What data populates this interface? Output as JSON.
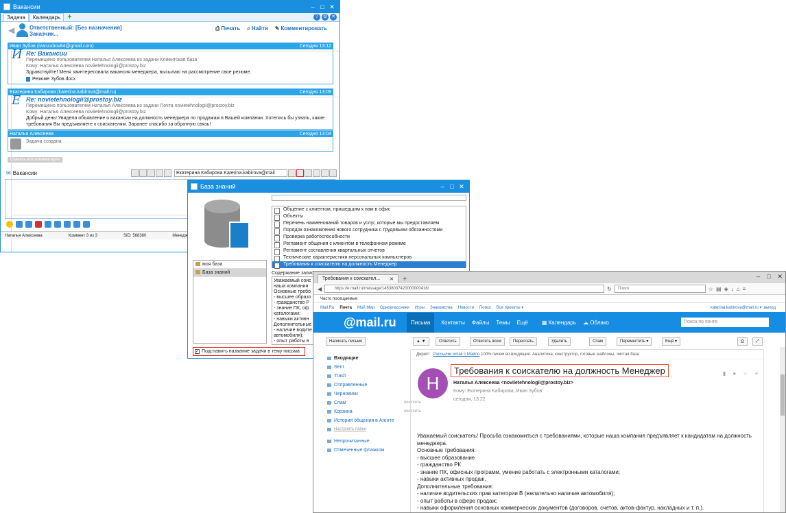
{
  "w1": {
    "title": "Вакансии",
    "tabs": [
      "Задача",
      "Календарь"
    ],
    "responsible": "Ответственный: [Без назначения]",
    "customer": "Заказчик...",
    "actions": [
      "Печать",
      "Найти",
      "Комментировать"
    ],
    "messages": [
      {
        "from": "Иван Зубов (ivanzubov84@gmail.com)",
        "time": "Сегодня 13:12",
        "letter": "И",
        "subject": "Re: Вакансии",
        "moved": "Перемещено пользователем Наталья Алексеева из задачи Клиентская база",
        "to": "Кому: Наталья Алексеева noviietehnologii@prostoy.biz",
        "text": "Здравствуйте! Меня заинтересовала вакансия менеджера, высылаю на рассмотрение свое резюме.",
        "attach": "Резюме Зубов.docx"
      },
      {
        "from": "Екатерина Кабирова (katerina.kabirova@mail.ru)",
        "time": "Сегодня 13:09",
        "letter": "E",
        "subject": "Re: novietehnologii@prostoy.biz",
        "moved": "Перемещено пользователем Наталья Алексеева из задачи Почта novietehnologii@prostoy.biz",
        "to": "Кому: Наталья Алексеева noviietehnologii@prostoy.biz",
        "text": "Добрый день! Увидела объявление о вакансии на должность менеджера по продажам в Вашей компании. Хотелось бы узнать, какие требования Вы предъявляете к соискателям. Заранее спасибо за обратную связь!"
      },
      {
        "from": "Наталья Алексеева",
        "time": "Сегодня 13:04",
        "text": "Задача создана"
      }
    ],
    "download_all": "Скачать все комментарии",
    "compose_label": "Вакансии",
    "recipient": "Екатерина Кабирова Katerina.kabirova@mail",
    "status": [
      "Наталья Алексеева",
      "Коммент 3 из 3",
      "SID: 568360",
      "Менеджм"
    ]
  },
  "w2": {
    "title": "База знаний",
    "tree": [
      "моя база",
      "База знаний"
    ],
    "items": [
      "Общение с клиентом, пришедшим к нам в офис",
      "Объекты",
      "Перечень наименований товаров и услуг, которые мы предоставляем",
      "Порядок ознакомления нового сотрудника с трудовыми обязанностями",
      "Проверка работоспособности",
      "Регламент общения с клиентом в телефонном режиме",
      "Регламент составления квартальных отчетов",
      "Технические характеристики персональных компьютеров",
      "Требования к соискателю на должность Менеджер"
    ],
    "content_label": "Содержание записи",
    "content_lines": [
      "Уважаемый соис",
      "наша компания",
      "Основные требо",
      "- высшее образо",
      "- гражданство Р",
      "- знание ПК, оф",
      "каталогами;",
      "- навыки активн",
      "Дополнительные",
      "- наличие водите",
      "автомобиля);",
      "- опыт работы в"
    ],
    "checkbox": "Подставить название задачи в тему письма"
  },
  "w3": {
    "tab_title": "Требования к соискател...",
    "url": "https://e.mail.ru/message/14538037420000000418/",
    "search_placeholder": "Поиск",
    "bookmark": "Часто посещаемые",
    "portal": [
      "Mail.Ru",
      "Почта",
      "Мой Мир",
      "Одноклассники",
      "Игры",
      "Знакомства",
      "Новости",
      "Поиск",
      "Все проекты ▾"
    ],
    "user": "katerina.kabirova@mail.ru ▾",
    "logout": "выход",
    "logo": "@mail.ru",
    "mail_tabs": [
      "Письма",
      "Контакты",
      "Файлы",
      "Темы",
      "Ещё"
    ],
    "calendar": "Календарь",
    "cloud": "Облако",
    "mail_search": "Поиск по почте",
    "write": "Написать письмо",
    "toolbar": [
      "Ответить",
      "Ответить всем",
      "Переслать",
      "Удалить",
      "Спам",
      "Переместить ▾",
      "Ещё ▾"
    ],
    "folders": [
      "Входящие",
      "Sent",
      "Trash",
      "Отправленные",
      "Черновики",
      "Спам",
      "Корзина",
      "История общения в Агенте",
      "Настроить папки",
      "Непрочитанные",
      "Отмеченные флажком"
    ],
    "clean": "очистить",
    "direct": "Директ",
    "direct_link": "Рассылки email с Майло",
    "direct_text": "100% писем во входящие. Аналитика, конструктор, готовые шаблоны, чистая база",
    "avatar_letter": "Н",
    "subject": "Требования к соискателю на должность Менеджер",
    "from": "Наталья Алексеева <noviietehnologii@prostoy.biz>",
    "to": "Кому: Екатерина Кабирова, Иван Зубов",
    "date": "сегодня, 13:22",
    "body": [
      "Уважаемый соискатель! Просьба ознакомиться с требованиями, которые наша компания предъявляет к кандидатам на должность менеджера.",
      "Основные требования:",
      "- высшее образование",
      "- гражданство РК",
      "- знание ПК, офисных программ, умение работать с электронными каталогами;",
      "- навыки активных продаж.",
      "Дополнительные требования:",
      "- наличие водительских прав категории В (желательно наличие автомобиля);",
      "- опыт работы в сфере продаж;",
      "- навыки оформления основных коммерческих документов (договоров, счетов, актов-фактур, накладных и т. п.)."
    ]
  }
}
